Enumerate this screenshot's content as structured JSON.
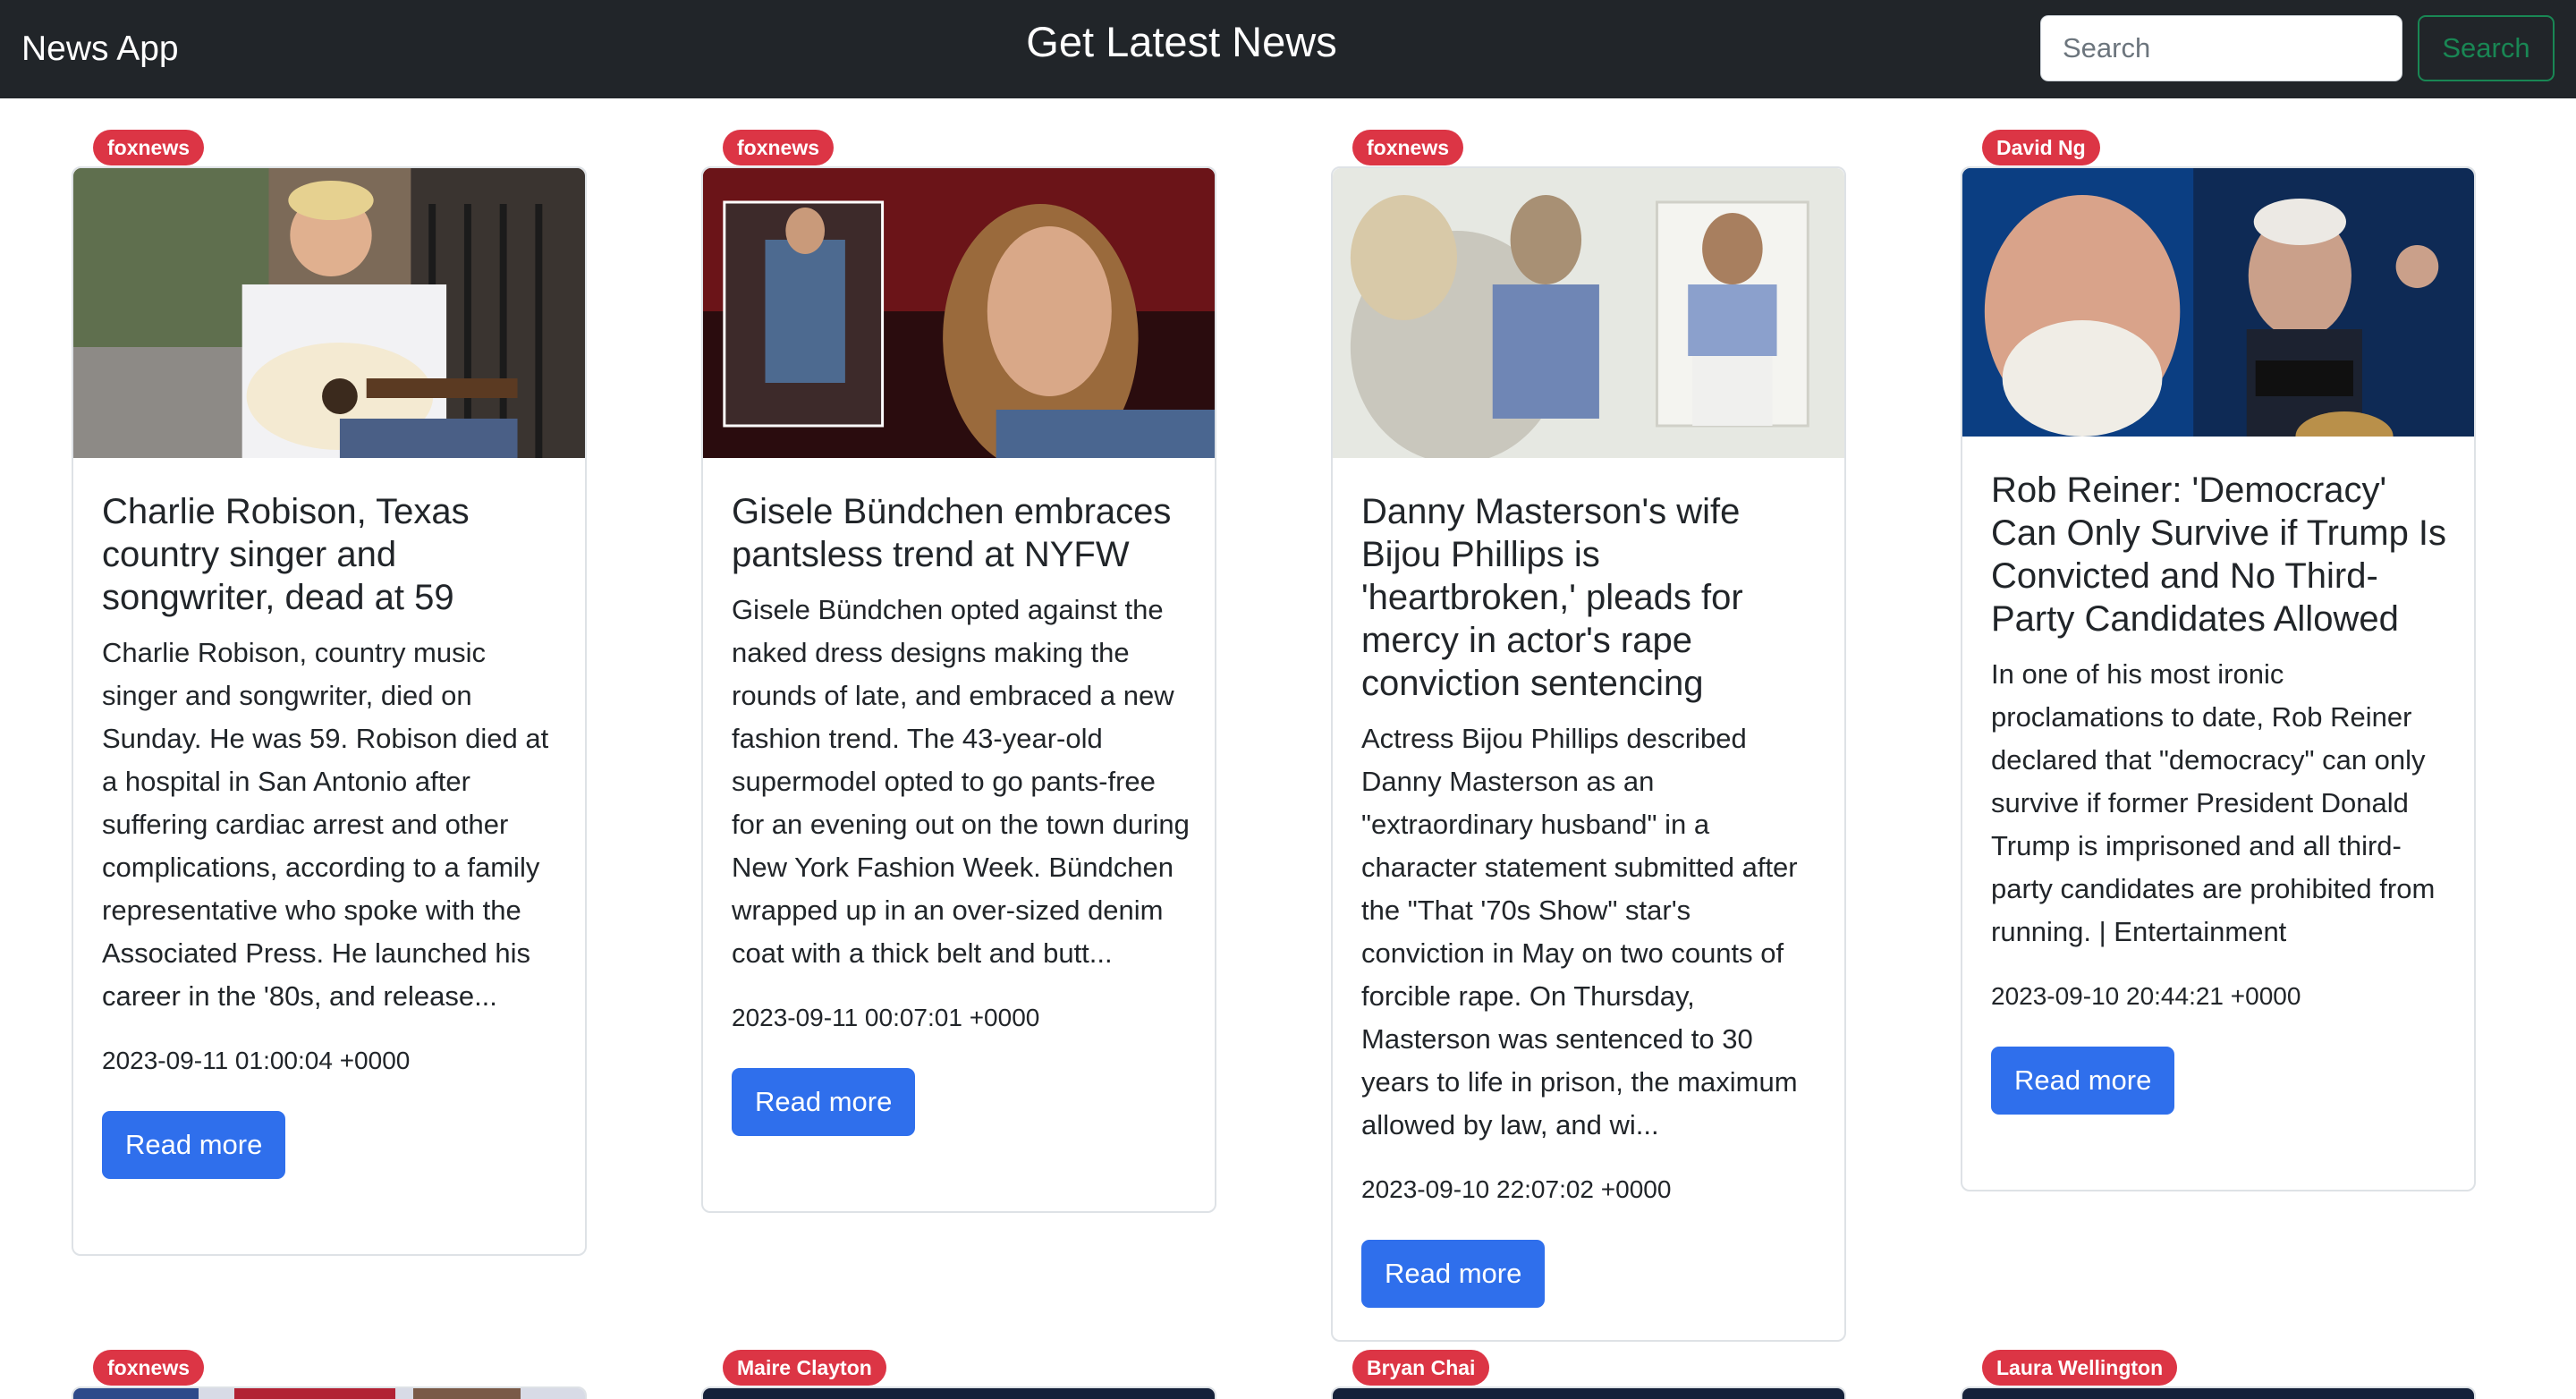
{
  "navbar": {
    "brand": "News App",
    "title": "Get Latest News",
    "search_placeholder": "Search",
    "search_button": "Search"
  },
  "articles": [
    {
      "source": "foxnews",
      "title": "Charlie Robison, Texas country singer and songwriter, dead at 59",
      "description": "Charlie Robison, country music singer and songwriter, died on Sunday. He was 59. Robison died at a hospital in San Antonio after suffering cardiac arrest and other complications, according to a family representative who spoke with the Associated Press. He launched his career in the '80s, and release...",
      "date": "2023-09-11 01:00:04 +0000",
      "button": "Read more"
    },
    {
      "source": "foxnews",
      "title": "Gisele Bündchen embraces pantsless trend at NYFW",
      "description": "Gisele Bündchen opted against the naked dress designs making the rounds of late, and embraced a new fashion trend. The 43-year-old supermodel opted to go pants-free for an evening out on the town during New York Fashion Week. Bündchen wrapped up in an over-sized denim coat with a thick belt and butt...",
      "date": "2023-09-11 00:07:01 +0000",
      "button": "Read more"
    },
    {
      "source": "foxnews",
      "title": "Danny Masterson's wife Bijou Phillips is 'heartbroken,' pleads for mercy in actor's rape conviction sentencing",
      "description": "Actress Bijou Phillips described Danny Masterson as an \"extraordinary husband\" in a character statement submitted after the \"That '70s Show\" star's conviction in May on two counts of forcible rape. On Thursday, Masterson was sentenced to 30 years to life in prison, the maximum allowed by law, and wi...",
      "date": "2023-09-10 22:07:02 +0000",
      "button": "Read more"
    },
    {
      "source": "David Ng",
      "title": "Rob Reiner: 'Democracy' Can Only Survive if Trump Is Convicted and No Third-Party Candidates Allowed",
      "description": "In one of his most ironic proclamations to date, Rob Reiner declared that \"democracy\" can only survive if former President Donald Trump is imprisoned and all third-party candidates are prohibited from running. | Entertainment",
      "date": "2023-09-10 20:44:21 +0000",
      "button": "Read more"
    }
  ],
  "next_row_sources": [
    "foxnews",
    "Maire Clayton",
    "Bryan Chai",
    "Laura Wellington"
  ],
  "colors": {
    "navbar": "#212529",
    "badge": "#dc3545",
    "primary": "#2f6fec",
    "success": "#198754"
  }
}
